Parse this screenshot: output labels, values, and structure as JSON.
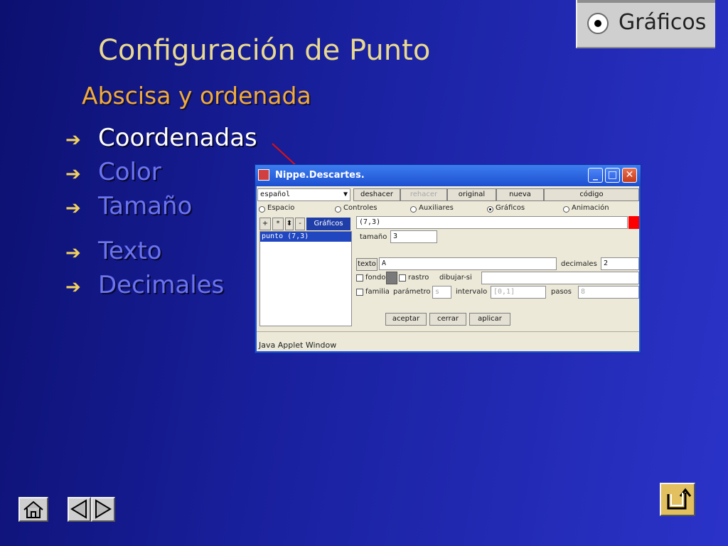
{
  "badge": {
    "label": "Gráficos"
  },
  "slide": {
    "title": "Configuración de Punto",
    "subtitle": "Abscisa y ordenada",
    "bullets": [
      "Coordenadas",
      "Color",
      "Tamaño",
      "Texto",
      "Decimales"
    ],
    "bullet_arrow": "➔",
    "active_bullet": "Coordenadas"
  },
  "window": {
    "title": "Nippe.Descartes.",
    "language_select": "español",
    "toolbar": [
      "deshacer",
      "rehacer",
      "original",
      "nueva",
      "código"
    ],
    "radios": [
      "Espacio",
      "Controles",
      "Auxiliares",
      "Gráficos",
      "Animación"
    ],
    "selected_radio": "Gráficos",
    "list_buttons": [
      "+",
      "*",
      "-"
    ],
    "list_header": "Gráficos",
    "list_items": [
      "punto (7,3)"
    ],
    "coord_value": "(7,3)",
    "color_swatch": "#ff0000",
    "tamano_label": "tamaño",
    "tamano_value": "3",
    "texto_button": "texto",
    "texto_value": "A",
    "decimales_label": "decimales",
    "decimales_value": "2",
    "fondo_label": "fondo",
    "rastro_label": "rastro",
    "dibujar_label": "dibujar-si",
    "familia_label": "familia",
    "parametro_label": "parámetro",
    "parametro_value": "s",
    "intervalo_label": "intervalo",
    "intervalo_value": "[0,1]",
    "pasos_label": "pasos",
    "pasos_value": "8",
    "bottom_buttons": [
      "aceptar",
      "cerrar",
      "aplicar"
    ],
    "status": "Java Applet Window"
  }
}
